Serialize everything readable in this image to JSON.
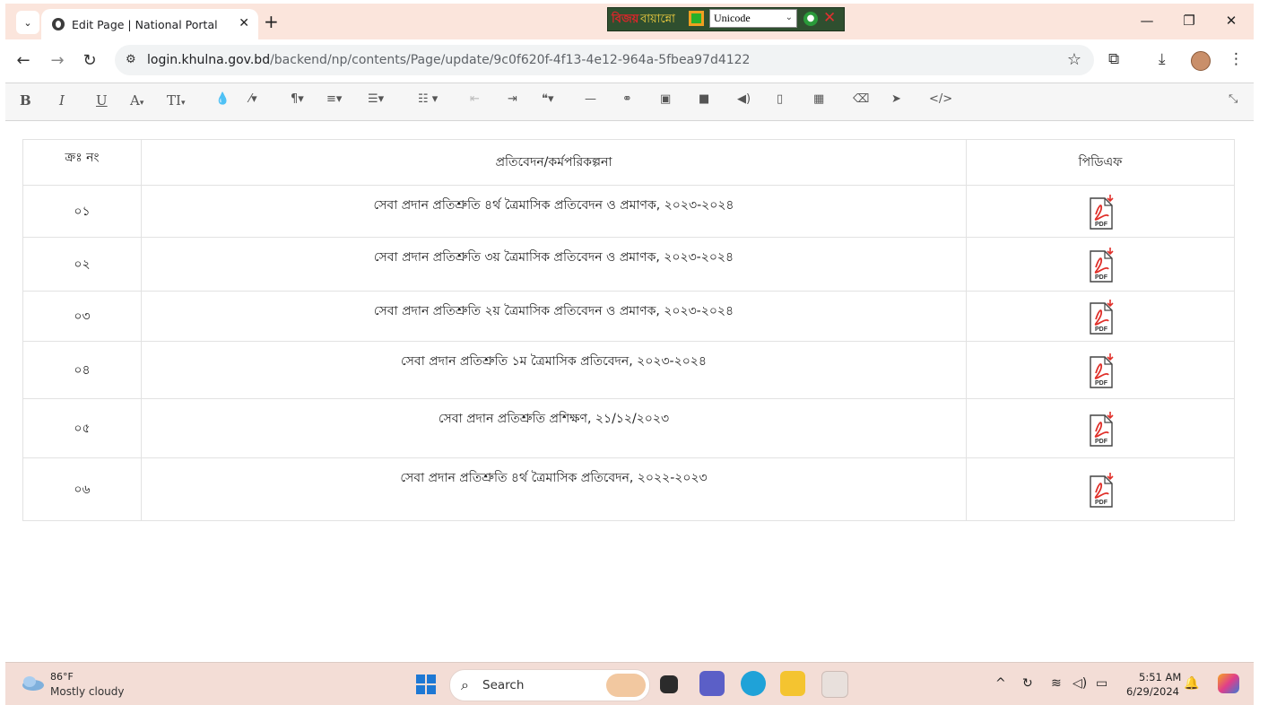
{
  "browser": {
    "tab_title": "Edit Page | National Portal",
    "url_host": "login.khulna.gov.bd",
    "url_path": "/backend/np/contents/Page/update/9c0f620f-4f13-4e12-964a-5fbea97d4122"
  },
  "ime": {
    "logo": "বিজয়",
    "name": "বায়ান্নো",
    "encoding": "Unicode"
  },
  "editor_toolbar": {
    "bold": "B",
    "italic": "I",
    "underline": "U",
    "font_color": "A",
    "font_size": "TI"
  },
  "table": {
    "headers": {
      "serial": "ক্রঃ নং",
      "title": "প্রতিবেদন/কর্মপরিকল্পনা",
      "pdf": "পিডিএফ"
    },
    "rows": [
      {
        "serial": "০১",
        "title": "সেবা প্রদান প্রতিশ্রুতি ৪র্থ ত্রৈমাসিক প্রতিবেদন ও প্রমাণক, ২০২৩-২০২৪"
      },
      {
        "serial": "০২",
        "title": "সেবা প্রদান প্রতিশ্রুতি ৩য় ত্রৈমাসিক প্রতিবেদন ও প্রমাণক, ২০২৩-২০২৪"
      },
      {
        "serial": "০৩",
        "title": "সেবা প্রদান প্রতিশ্রুতি ২য় ত্রৈমাসিক প্রতিবেদন ও প্রমাণক, ২০২৩-২০২৪"
      },
      {
        "serial": "০৪",
        "title": "সেবা প্রদান প্রতিশ্রুতি ১ম ত্রৈমাসিক প্রতিবেদন, ২০২৩-২০২৪"
      },
      {
        "serial": "০৫",
        "title": "সেবা প্রদান প্রতিশ্রুতি প্রশিক্ষণ, ২১/১২/২০২৩"
      },
      {
        "serial": "০৬",
        "title": "সেবা প্রদান প্রতিশ্রুতি ৪র্থ ত্রৈমাসিক প্রতিবেদন, ২০২২-২০২৩"
      }
    ],
    "pdf_label": "PDF"
  },
  "taskbar": {
    "weather_temp": "86°F",
    "weather_desc": "Mostly cloudy",
    "search_label": "Search",
    "time": "5:51 AM",
    "date": "6/29/2024"
  }
}
